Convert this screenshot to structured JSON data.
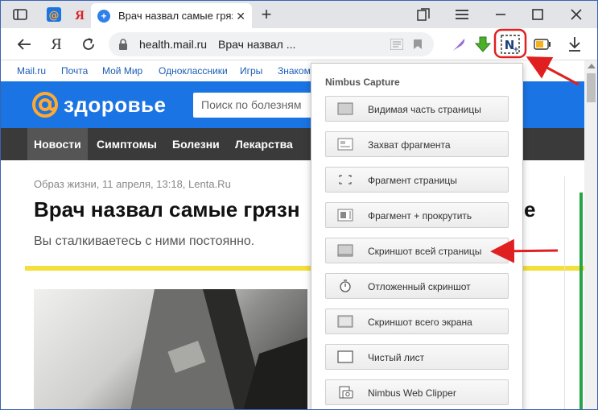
{
  "browser": {
    "tab_title": "Врач назвал самые грязные",
    "tab_close": "✕",
    "new_tab": "+",
    "domain": "health.mail.ru",
    "page_title": "Врач назвал ..."
  },
  "portal_links": [
    "Mail.ru",
    "Почта",
    "Мой Мир",
    "Одноклассники",
    "Игры",
    "Знаком"
  ],
  "site": {
    "logo_text": "здоровье",
    "search_placeholder": "Поиск по болезням",
    "menu": [
      "Новости",
      "Симптомы",
      "Болезни",
      "Лекарства"
    ]
  },
  "article": {
    "meta": "Образ жизни, 11 апреля, 13:18, Lenta.Ru",
    "headline_left": "Врач назвал самые грязн",
    "headline_right": "е",
    "subhead": "Вы сталкиваетесь с ними постоянно."
  },
  "popup": {
    "title": "Nimbus Capture",
    "items": [
      {
        "label": "Видимая часть страницы",
        "icon": "visible-area-icon"
      },
      {
        "label": "Захват фрагмента",
        "icon": "fragment-icon"
      },
      {
        "label": "Фрагмент страницы",
        "icon": "page-fragment-icon"
      },
      {
        "label": "Фрагмент + прокрутить",
        "icon": "fragment-scroll-icon"
      },
      {
        "label": "Скриншот всей страницы",
        "icon": "full-page-icon"
      },
      {
        "label": "Отложенный скриншот",
        "icon": "timer-icon"
      },
      {
        "label": "Скриншот всего экрана",
        "icon": "full-screen-icon"
      },
      {
        "label": "Чистый лист",
        "icon": "blank-sheet-icon"
      },
      {
        "label": "Nimbus Web Clipper",
        "icon": "camera-icon"
      }
    ]
  },
  "colors": {
    "accent_blue": "#1b74e4",
    "menu_dark": "#3a3a3a",
    "highlight_red": "#e02020",
    "yellow_rule": "#f3e03a"
  }
}
